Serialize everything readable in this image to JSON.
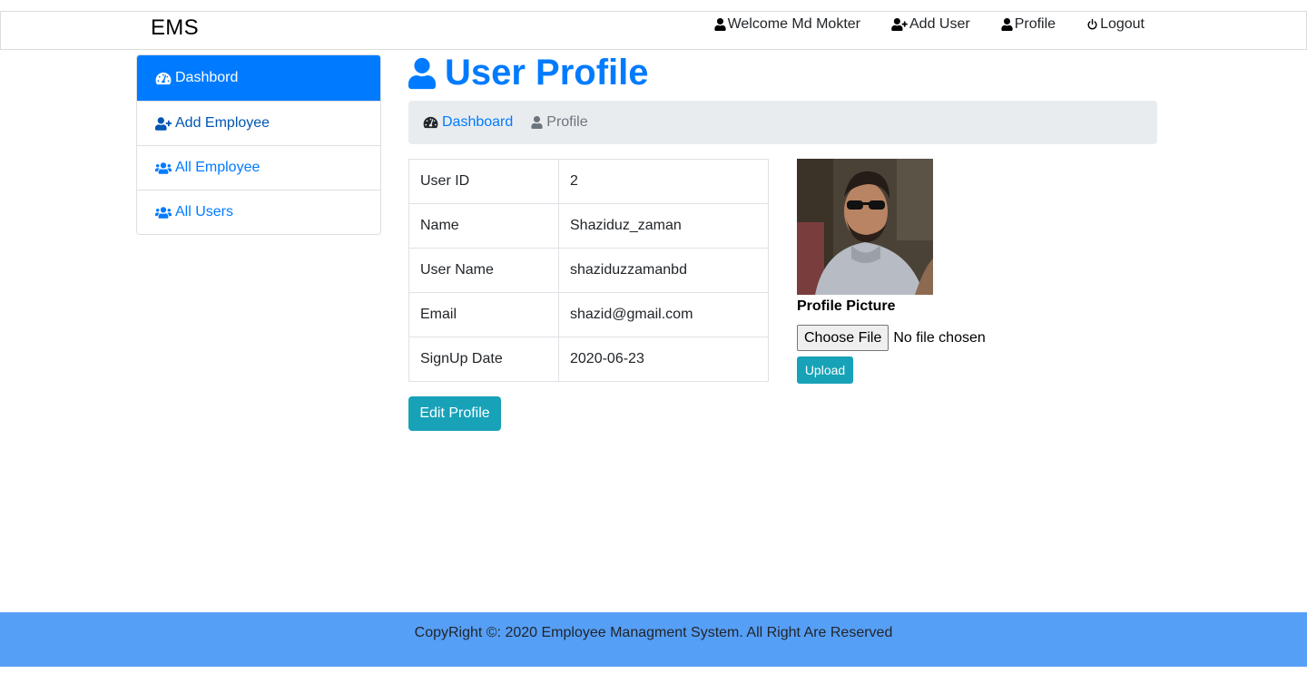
{
  "navbar": {
    "brand": "EMS",
    "links": [
      {
        "label": "Welcome Md Mokter",
        "icon": "user-icon"
      },
      {
        "label": "Add User",
        "icon": "user-plus-icon"
      },
      {
        "label": "Profile",
        "icon": "user-icon"
      },
      {
        "label": "Logout",
        "icon": "power-icon"
      }
    ]
  },
  "sidebar": {
    "items": [
      {
        "label": "Dashbord",
        "icon": "tachometer-icon",
        "active": true
      },
      {
        "label": "Add Employee",
        "icon": "user-plus-icon"
      },
      {
        "label": "All Employee",
        "icon": "users-icon"
      },
      {
        "label": "All Users",
        "icon": "users-icon"
      }
    ]
  },
  "page": {
    "title": "User Profile",
    "title_icon": "user-icon"
  },
  "breadcrumb": {
    "items": [
      {
        "label": "Dashboard",
        "icon": "tachometer-icon"
      },
      {
        "label": "Profile",
        "icon": "user-icon"
      }
    ]
  },
  "profile_table": {
    "rows": [
      {
        "key": "User ID",
        "value": "2"
      },
      {
        "key": "Name",
        "value": "Shaziduz_zaman"
      },
      {
        "key": "User Name",
        "value": "shaziduzzamanbd"
      },
      {
        "key": "Email",
        "value": "shazid@gmail.com"
      },
      {
        "key": "SignUp Date",
        "value": "2020-06-23"
      }
    ]
  },
  "actions": {
    "edit_label": "Edit Profile",
    "upload_label": "Upload"
  },
  "picture": {
    "label": "Profile Picture",
    "choose_label": "Choose File",
    "status": "No file chosen"
  },
  "footer": {
    "text": "CopyRight ©: 2020 Employee Managment System. All Right Are Reserved"
  },
  "colors": {
    "primary": "#007bff",
    "info": "#17a2b8",
    "footer_bg": "#569ff7",
    "breadcrumb_bg": "#e9ecef"
  }
}
